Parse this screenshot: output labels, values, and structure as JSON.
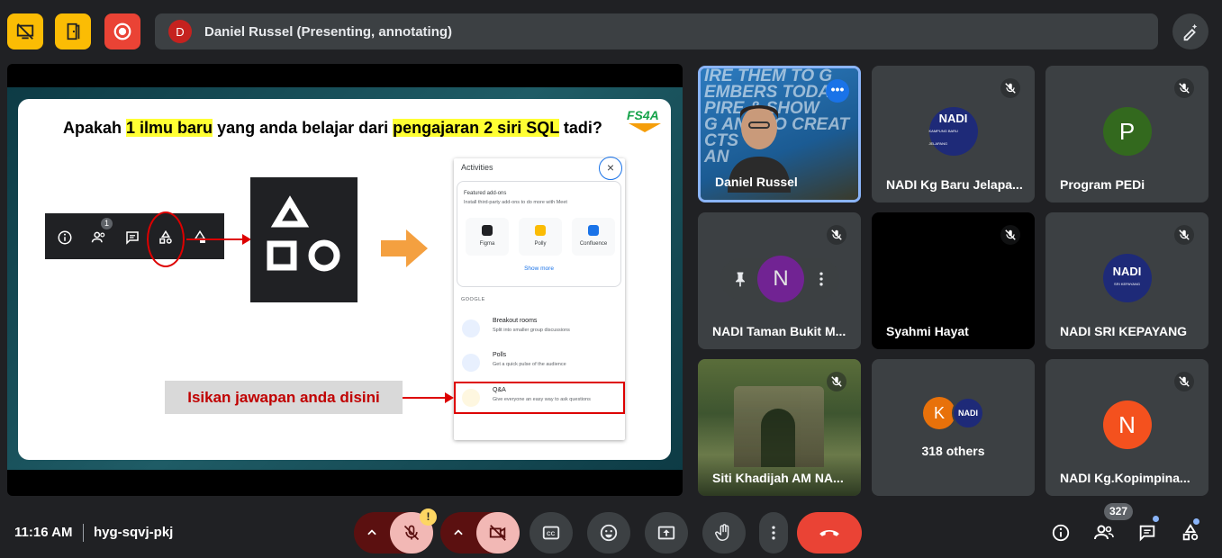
{
  "presenter": {
    "avatar_initial": "D",
    "label": "Daniel Russel (Presenting, annotating)"
  },
  "slide": {
    "title_part1": "Apakah ",
    "title_hl1": "1 ilmu baru",
    "title_part2": " yang anda belajar dari ",
    "title_hl2": "pengajaran 2 siri SQL",
    "title_part3": " tadi?",
    "logo": "FS4A",
    "toolbar_badge": "1",
    "callout": "Isikan jawapan anda disini",
    "activities": {
      "title": "Activities",
      "close": "×",
      "featured_heading": "Featured add-ons",
      "featured_sub": "Install third-party add-ons to do more with Meet",
      "addons": [
        "Figma",
        "Polly",
        "Confluence"
      ],
      "show_more": "Show more",
      "section": "GOOGLE",
      "items": [
        {
          "title": "Breakout rooms",
          "sub": "Split into smaller group discussions"
        },
        {
          "title": "Polls",
          "sub": "Get a quick pulse of the audience"
        },
        {
          "title": "Q&A",
          "sub": "Give everyone an easy way to ask questions"
        }
      ]
    }
  },
  "tiles": [
    {
      "name": "Daniel Russel",
      "video_text": "IRE THEM TO G\nEMBERS TODAY\nPIRE & SHOW\nG AND TO CREAT\nCTS\nAN"
    },
    {
      "name": "NADI Kg Baru Jelapa...",
      "logo": "NADI",
      "logo_sub": "KAMPUNG BARU JELAPANG"
    },
    {
      "name": "Program PEDi",
      "initial": "P"
    },
    {
      "name": "NADI Taman Bukit M...",
      "initial": "N"
    },
    {
      "name": "Syahmi Hayat"
    },
    {
      "name": "NADI SRI KEPAYANG",
      "logo": "NADI",
      "logo_sub": "SRI KEPAYANG"
    },
    {
      "name": "Siti Khadijah AM NA..."
    },
    {
      "name": "318 others",
      "initial": "K",
      "logo": "NADI"
    },
    {
      "name": "NADI Kg.Kopimpina...",
      "initial": "N"
    }
  ],
  "bottom": {
    "time": "11:16 AM",
    "meeting_code": "hyg-sqvj-pkj",
    "warning": "!",
    "participant_count": "327"
  },
  "colors": {
    "background": "#202124",
    "tile": "#3c4043",
    "end_call": "#ea4335",
    "accent": "#8ab4f8",
    "warning_yellow": "#fdd663",
    "host_control": "#fbbc04"
  }
}
